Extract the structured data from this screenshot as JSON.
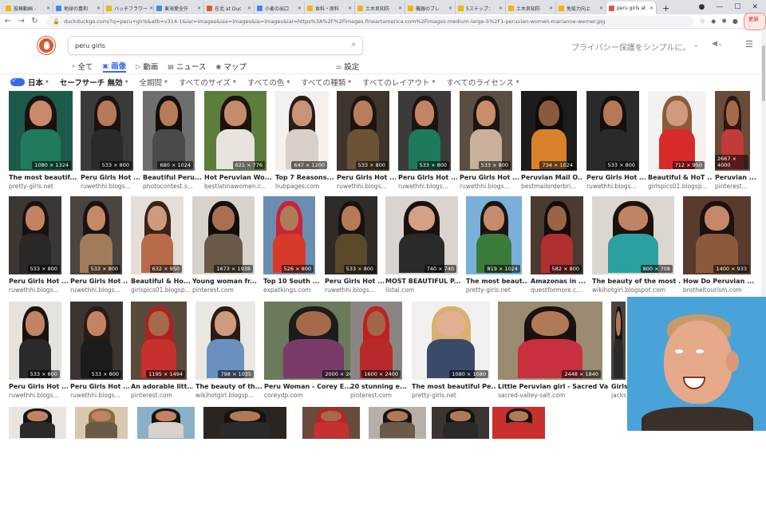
{
  "browser": {
    "tabs": [
      {
        "label": "投稿動画 -",
        "color": "#f4b400"
      },
      {
        "label": "地球の豊和",
        "color": "#4285f4"
      },
      {
        "label": "バッチフラワー",
        "color": "#f4b400"
      },
      {
        "label": "東海愛全仟",
        "color": "#4285f4"
      },
      {
        "label": "在北 at Duc",
        "color": "#de5833"
      },
      {
        "label": "小麦の出口",
        "color": "#4285f4"
      },
      {
        "label": "食料・原料",
        "color": "#f4b400"
      },
      {
        "label": "土木良知防",
        "color": "#f4b400"
      },
      {
        "label": "機器のブレ",
        "color": "#f4b400"
      },
      {
        "label": "5ステップ：",
        "color": "#f4b400"
      },
      {
        "label": "土木良知防",
        "color": "#f4b400"
      },
      {
        "label": "免疫力向上",
        "color": "#f4b400"
      },
      {
        "label": "peru girls at",
        "color": "#de5833",
        "active": true
      }
    ],
    "new_tab": "+",
    "url": "duckduckgo.com/?q=peru+girls&atb=v314-1&iar=images&iax=images&ia=images&iai=https%3A%2F%2Fimages.fineartamerica.com%2Fimages-medium-large-5%2F1-peruvian-women-marianne-werner.jpg",
    "restart_label": "更新 :"
  },
  "search": {
    "query": "peru girls",
    "promo": "プライバシー保護をシンプルに。"
  },
  "nav": {
    "all": "全て",
    "images": "画像",
    "videos": "動画",
    "news": "ニュース",
    "maps": "マップ",
    "settings": "設定"
  },
  "filters": {
    "region": "日本",
    "safe": "セーフサーチ 無効",
    "time": "全期間",
    "size": "すべてのサイズ",
    "color": "すべての色",
    "type": "すべての種類",
    "layout": "すべてのレイアウト",
    "license": "すべてのライセンス"
  },
  "rows": [
    [
      {
        "cap": "The most beautif...",
        "src": "pretty-girls.net",
        "dim": "1080 × 1324",
        "bg": "#1d5a4a",
        "skin": "#c88a68",
        "hair": "#1a1210",
        "cloth": "#1f7a5e"
      },
      {
        "cap": "Peru Girls Hot ...",
        "src": "ruwethhi.blogs...",
        "dim": "533 × 800",
        "bg": "#3b3a3a",
        "skin": "#b57a58",
        "hair": "#1a1210",
        "cloth": "#2a2a2a"
      },
      {
        "cap": "Beautiful Peru...",
        "src": "photocontest.s...",
        "dim": "680 × 1024",
        "bg": "#6e6e6e",
        "skin": "#b77b59",
        "hair": "#140d0b",
        "cloth": "#4a4a4a"
      },
      {
        "cap": "Hot Peruvian Wo...",
        "src": "bestlatinawomen.c...",
        "dim": "621 × 776",
        "bg": "#5c7d3c",
        "skin": "#c48c6c",
        "hair": "#1c1310",
        "cloth": "#e8e3dd"
      },
      {
        "cap": "Top 7 Reasons...",
        "src": "hubpages.com",
        "dim": "647 × 1200",
        "bg": "#f3f0ee",
        "skin": "#c9937a",
        "hair": "#2a1d18",
        "cloth": "#d8cfc8"
      },
      {
        "cap": "Peru Girls Hot ...",
        "src": "ruwethhi.blogs...",
        "dim": "533 × 800",
        "bg": "#3e352c",
        "skin": "#b97d59",
        "hair": "#1c1410",
        "cloth": "#6b5436"
      },
      {
        "cap": "Peru Girls Hot ...",
        "src": "ruwethhi.blogs...",
        "dim": "533 × 800",
        "bg": "#3c3b3a",
        "skin": "#c18565",
        "hair": "#1c1410",
        "cloth": "#1d7a5c"
      },
      {
        "cap": "Peru Girls Hot ...",
        "src": "ruwethhi.blogs...",
        "dim": "533 × 800",
        "bg": "#5a4d42",
        "skin": "#c88e6c",
        "hair": "#1c1410",
        "cloth": "#c8b09a"
      },
      {
        "cap": "Peruvian Mail O...",
        "src": "bestmailorderbri...",
        "dim": "734 × 1024",
        "bg": "#1c1c1c",
        "skin": "#8a5a3e",
        "hair": "#0f0b09",
        "cloth": "#d9822b"
      },
      {
        "cap": "Peru Girls Hot ...",
        "src": "ruwethhi.blogs...",
        "dim": "533 × 800",
        "bg": "#2b2b2b",
        "skin": "#b57858",
        "hair": "#140f0c",
        "cloth": "#2a2a2a"
      },
      {
        "cap": "Beautiful & HoT ...",
        "src": "girlspics01.blogsp...",
        "dim": "712 × 950",
        "bg": "#f4f2f0",
        "skin": "#d19a7c",
        "hair": "#8a5b3a",
        "cloth": "#d92a2a"
      },
      {
        "cap": "Peruvian ...",
        "src": "pinterest...",
        "dim": "2667 × 4000",
        "bg": "#6b4a3a",
        "skin": "#a56a4a",
        "hair": "#2a1a14",
        "cloth": "#c23a3a"
      }
    ],
    [
      {
        "cap": "Peru Girls Hot ...",
        "src": "ruwethhi.blogs...",
        "dim": "533 × 800",
        "bg": "#3a3734",
        "skin": "#c08464",
        "hair": "#1a120f",
        "cloth": "#2a2725"
      },
      {
        "cap": "Peru Girls Hot ...",
        "src": "ruwethhi.blogs...",
        "dim": "533 × 800",
        "bg": "#4a4540",
        "skin": "#c38868",
        "hair": "#1a120f",
        "cloth": "#a27b5b"
      },
      {
        "cap": "Beautiful & Ho...",
        "src": "girlspics01.blogsp...",
        "dim": "632 × 950",
        "bg": "#e5ded8",
        "skin": "#cf9a7c",
        "hair": "#3a2418",
        "cloth": "#b86b4a"
      },
      {
        "cap": "Young woman fr...",
        "src": "pinterest.com",
        "dim": "1673 × 1938",
        "bg": "#d8d2cc",
        "skin": "#a9704f",
        "hair": "#120c0a",
        "cloth": "#6a5a4a"
      },
      {
        "cap": "Top 10 South ...",
        "src": "expatkings.com",
        "dim": "526 × 800",
        "bg": "#6b8db0",
        "skin": "#b07a58",
        "hair": "#c8243a",
        "cloth": "#d83a2a"
      },
      {
        "cap": "Peru Girls Hot ...",
        "src": "ruwethhi.blogs...",
        "dim": "533 × 800",
        "bg": "#2e2b28",
        "skin": "#b57a58",
        "hair": "#1a120f",
        "cloth": "#5a4a2a"
      },
      {
        "cap": "MOST BEAUTIFUL P...",
        "src": "listal.com",
        "dim": "740 × 740",
        "bg": "#d9d4d0",
        "skin": "#d4a185",
        "hair": "#1a1210",
        "cloth": "#2a2a2a"
      },
      {
        "cap": "The most beaut...",
        "src": "pretty-girls.net",
        "dim": "819 × 1024",
        "bg": "#7ab0d8",
        "skin": "#c48c6c",
        "hair": "#1c1410",
        "cloth": "#3a7a3a"
      },
      {
        "cap": "Amazonas in ...",
        "src": "questformore.c...",
        "dim": "582 × 800",
        "bg": "#4a3a30",
        "skin": "#9a6446",
        "hair": "#140d0a",
        "cloth": "#b03030"
      },
      {
        "cap": "The beauty of the most ...",
        "src": "wikihotgirl.blogspot.com",
        "dim": "800 × 708",
        "bg": "#dcd6d0",
        "skin": "#c08464",
        "hair": "#1a120f",
        "cloth": "#2aa0a0"
      },
      {
        "cap": "How Do Peruvian ...",
        "src": "brotheltourism.com",
        "dim": "1400 × 933",
        "bg": "#5a3a2c",
        "skin": "#c48868",
        "hair": "#1a120f",
        "cloth": "#8a5a3a"
      }
    ],
    [
      {
        "cap": "Peru Girls Hot ...",
        "src": "ruwethhi.blogs...",
        "dim": "533 × 800",
        "bg": "#e6e2de",
        "skin": "#c08464",
        "hair": "#1a120f",
        "cloth": "#2a2a2a"
      },
      {
        "cap": "Peru Girls Hot ...",
        "src": "ruwethhi.blogs...",
        "dim": "533 × 800",
        "bg": "#3a3532",
        "skin": "#c08464",
        "hair": "#2a1a14",
        "cloth": "#1c1c1c"
      },
      {
        "cap": "An adorable litt...",
        "src": "pinterest.com",
        "dim": "1195 × 1494",
        "bg": "#5a4a3a",
        "skin": "#a56a4a",
        "hair": "#b02020",
        "cloth": "#c83030"
      },
      {
        "cap": "The beauty of th...",
        "src": "wikihotgirl.blogsp...",
        "dim": "798 × 1035",
        "bg": "#eae6e2",
        "skin": "#d09a7c",
        "hair": "#2a1a14",
        "cloth": "#6a90c0"
      },
      {
        "cap": "Peru Woman - Corey E...",
        "src": "coreydp.com",
        "dim": "2000 × 2000",
        "bg": "#6a7a5a",
        "skin": "#a56a4a",
        "hair": "#1c1c1c",
        "cloth": "#7a3a6a"
      },
      {
        "cap": "20 stunning e...",
        "src": "pinterest.com",
        "dim": "1600 × 2400",
        "bg": "#8a8580",
        "skin": "#a06848",
        "hair": "#c02020",
        "cloth": "#b82a2a"
      },
      {
        "cap": "The most beautiful Pe...",
        "src": "pretty-girls.net",
        "dim": "1080 × 1080",
        "bg": "#f2f0ee",
        "skin": "#e0b090",
        "hair": "#d8b070",
        "cloth": "#3a4a6a"
      },
      {
        "cap": "Little Peruvian girl - Sacred Val...",
        "src": "sacred-valley-salt.com",
        "dim": "2448 × 1840",
        "bg": "#9a8a70",
        "skin": "#b07a58",
        "hair": "#1a120f",
        "cloth": "#c83040"
      },
      {
        "cap": "Girls",
        "src": "jacks",
        "dim": "",
        "bg": "#4a4540",
        "skin": "#b07a58",
        "hair": "#1a120f",
        "cloth": "#2a2a2a"
      }
    ],
    [
      {
        "cap": "",
        "src": "",
        "dim": "",
        "bg": "#e8e4e0",
        "skin": "#c08464",
        "hair": "#1a120f",
        "cloth": "#2a2a2a"
      },
      {
        "cap": "",
        "src": "",
        "dim": "",
        "bg": "#d8c8b0",
        "skin": "#c08464",
        "hair": "#8a6a3a",
        "cloth": "#6a5a4a"
      },
      {
        "cap": "",
        "src": "",
        "dim": "",
        "bg": "#8ab0c8",
        "skin": "#c08464",
        "hair": "#1a120f",
        "cloth": "#d8d2cc"
      },
      {
        "cap": "",
        "src": "",
        "dim": "",
        "bg": "#2a2520",
        "skin": "#b07a58",
        "hair": "#1a120f",
        "cloth": "#2a2a2a"
      },
      {
        "cap": "",
        "src": "",
        "dim": "",
        "bg": "#6a4a3a",
        "skin": "#a56a4a",
        "hair": "#c02020",
        "cloth": "#c83030"
      },
      {
        "cap": "",
        "src": "",
        "dim": "",
        "bg": "#b8b0a8",
        "skin": "#b07a58",
        "hair": "#1a120f",
        "cloth": "#6a5a4a"
      },
      {
        "cap": "",
        "src": "",
        "dim": "",
        "bg": "#3a3532",
        "skin": "#b07a58",
        "hair": "#1a120f",
        "cloth": "#2a2a2a"
      },
      {
        "cap": "",
        "src": "",
        "dim": "",
        "bg": "#c83030",
        "skin": "#b07a58",
        "hair": "#1a120f",
        "cloth": "#c83030"
      }
    ]
  ]
}
